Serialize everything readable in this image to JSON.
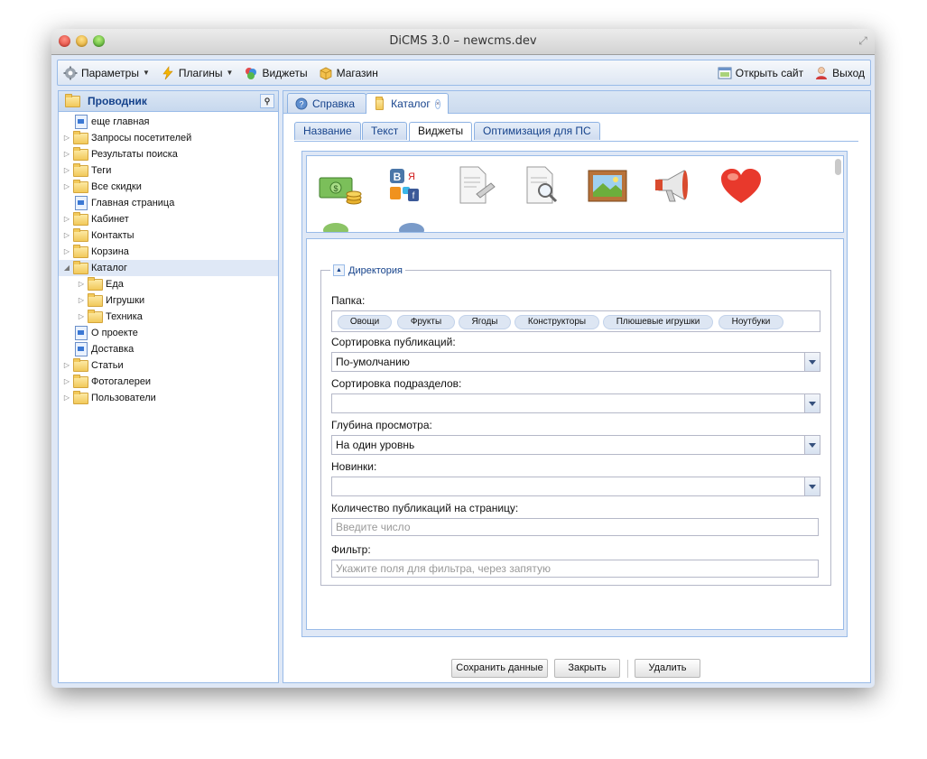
{
  "window": {
    "title": "DiCMS 3.0 – newcms.dev"
  },
  "toolbar": {
    "params": "Параметры",
    "plugins": "Плагины",
    "widgets": "Виджеты",
    "shop": "Магазин",
    "open_site": "Открыть сайт",
    "logout": "Выход"
  },
  "explorer": {
    "title": "Проводник",
    "items": [
      {
        "label": "еще главная"
      },
      {
        "label": "Запросы посетителей"
      },
      {
        "label": "Результаты поиска"
      },
      {
        "label": "Теги"
      },
      {
        "label": "Все скидки"
      },
      {
        "label": "Главная страница"
      },
      {
        "label": "Кабинет"
      },
      {
        "label": "Контакты"
      },
      {
        "label": "Корзина"
      },
      {
        "label": "Каталог"
      },
      {
        "label": "Еда"
      },
      {
        "label": "Игрушки"
      },
      {
        "label": "Техника"
      },
      {
        "label": "О проекте"
      },
      {
        "label": "Доставка"
      },
      {
        "label": "Статьи"
      },
      {
        "label": "Фотогалереи"
      },
      {
        "label": "Пользователи"
      }
    ]
  },
  "tabs": {
    "help": "Справка",
    "catalog": "Каталог"
  },
  "subtabs": [
    "Название",
    "Текст",
    "Виджеты",
    "Оптимизация для ПС"
  ],
  "form": {
    "fieldset": "Директория",
    "folder_label": "Папка:",
    "tags": [
      "Овощи",
      "Фрукты",
      "Ягоды",
      "Конструкторы",
      "Плюшевые игрушки",
      "Ноутбуки"
    ],
    "sort_pub_label": "Сортировка публикаций:",
    "sort_pub_value": "По-умолчанию",
    "sort_sub_label": "Сортировка подразделов:",
    "sort_sub_value": "",
    "depth_label": "Глубина просмотра:",
    "depth_value": "На один уровнь",
    "new_label": "Новинки:",
    "new_value": "",
    "count_label": "Количество публикаций на страницу:",
    "count_placeholder": "Введите число",
    "filter_label": "Фильтр:",
    "filter_placeholder": "Укажите поля для фильтра, через запятую"
  },
  "buttons": {
    "save": "Сохранить данные",
    "close": "Закрыть",
    "delete": "Удалить"
  }
}
